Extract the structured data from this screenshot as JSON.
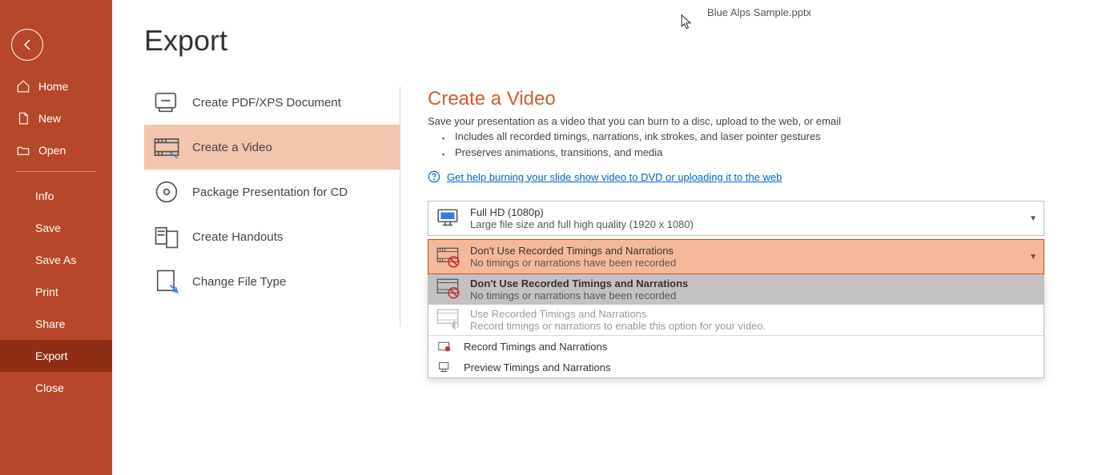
{
  "document_title": "Blue Alps Sample.pptx",
  "page_title": "Export",
  "sidebar": {
    "home": "Home",
    "new": "New",
    "open": "Open",
    "info": "Info",
    "save": "Save",
    "save_as": "Save As",
    "print": "Print",
    "share": "Share",
    "export": "Export",
    "close": "Close"
  },
  "export_options": [
    {
      "label": "Create PDF/XPS Document"
    },
    {
      "label": "Create a Video"
    },
    {
      "label": "Package Presentation for CD"
    },
    {
      "label": "Create Handouts"
    },
    {
      "label": "Change File Type"
    }
  ],
  "video_panel": {
    "heading": "Create a Video",
    "desc": "Save your presentation as a video that you can burn to a disc, upload to the web, or email",
    "bullet1": "Includes all recorded timings, narrations, ink strokes, and laser pointer gestures",
    "bullet2": "Preserves animations, transitions, and media",
    "help_link": "Get help burning your slide show video to DVD or uploading it to the web",
    "quality": {
      "title": "Full HD (1080p)",
      "sub": "Large file size and full high quality (1920 x 1080)"
    },
    "timings": {
      "title": "Don't Use Recorded Timings and Narrations",
      "sub": "No timings or narrations have been recorded"
    },
    "dropdown": {
      "opt1_title": "Don't Use Recorded Timings and Narrations",
      "opt1_sub": "No timings or narrations have been recorded",
      "opt2_title": "Use Recorded Timings and Narrations",
      "opt2_sub": "Record timings or narrations to enable this option for your video.",
      "record": "Record Timings and Narrations",
      "preview": "Preview Timings and Narrations"
    }
  }
}
